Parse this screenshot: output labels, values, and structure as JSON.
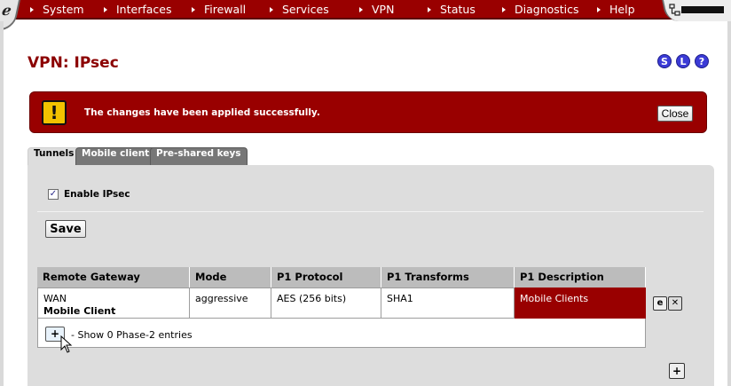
{
  "nav": {
    "logo_char": "e",
    "items": [
      {
        "label": "System"
      },
      {
        "label": "Interfaces"
      },
      {
        "label": "Firewall"
      },
      {
        "label": "Services"
      },
      {
        "label": "VPN"
      },
      {
        "label": "Status"
      },
      {
        "label": "Diagnostics"
      },
      {
        "label": "Help"
      }
    ]
  },
  "page": {
    "title": "VPN: IPsec",
    "help_icons": [
      {
        "label": "S",
        "icon": "status-icon"
      },
      {
        "label": "L",
        "icon": "log-icon"
      },
      {
        "label": "?",
        "icon": "help-icon"
      }
    ]
  },
  "alert": {
    "icon": "!",
    "message": "The changes have been applied successfully.",
    "close_label": "Close"
  },
  "tabs": [
    {
      "label": "Tunnels",
      "active": true
    },
    {
      "label": "Mobile clients",
      "active": false
    },
    {
      "label": "Pre-shared keys",
      "active": false
    }
  ],
  "settings": {
    "enable_label": "Enable IPsec",
    "enable_checked": true,
    "save_label": "Save"
  },
  "table": {
    "headers": [
      "Remote Gateway",
      "Mode",
      "P1 Protocol",
      "P1 Transforms",
      "P1 Description"
    ],
    "rows": [
      {
        "remote_gateway": "WAN",
        "remote_gateway_line2": "Mobile Client",
        "mode": "aggressive",
        "p1_protocol": "AES (256 bits)",
        "p1_transforms": "SHA1",
        "p1_description": "Mobile Clients"
      }
    ],
    "phase2_add": "+",
    "phase2_text": "- Show 0 Phase-2 entries"
  },
  "colors": {
    "brand": "#990000",
    "panel": "#dddddd",
    "header": "#bcbcbc"
  }
}
